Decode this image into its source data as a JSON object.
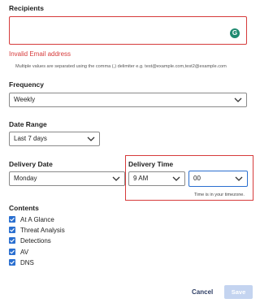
{
  "recipients": {
    "label": "Recipients",
    "value": "",
    "error": "Invalid Email address",
    "hint": "Multiple values are separated using the comma (,) delimiter e.g. test@example.com,test2@example.com",
    "grammarly_icon_letter": "G"
  },
  "frequency": {
    "label": "Frequency",
    "selected": "Weekly"
  },
  "date_range": {
    "label": "Date Range",
    "selected": "Last 7 days"
  },
  "delivery_date": {
    "label": "Delivery Date",
    "selected": "Monday"
  },
  "delivery_time": {
    "label": "Delivery Time",
    "hour_selected": "9 AM",
    "minute_selected": "00",
    "timezone_note": "Time is in your timezone."
  },
  "contents": {
    "label": "Contents",
    "items": [
      {
        "label": "At A Glance",
        "checked": true
      },
      {
        "label": "Threat Analysis",
        "checked": true
      },
      {
        "label": "Detections",
        "checked": true
      },
      {
        "label": "AV",
        "checked": true
      },
      {
        "label": "DNS",
        "checked": true
      }
    ]
  },
  "footer": {
    "cancel_label": "Cancel",
    "save_label": "Save"
  },
  "colors": {
    "error": "#d63b3b",
    "checkbox": "#2a6fd0",
    "save_disabled": "#c4d4f0",
    "grammarly": "#1f8a70"
  }
}
